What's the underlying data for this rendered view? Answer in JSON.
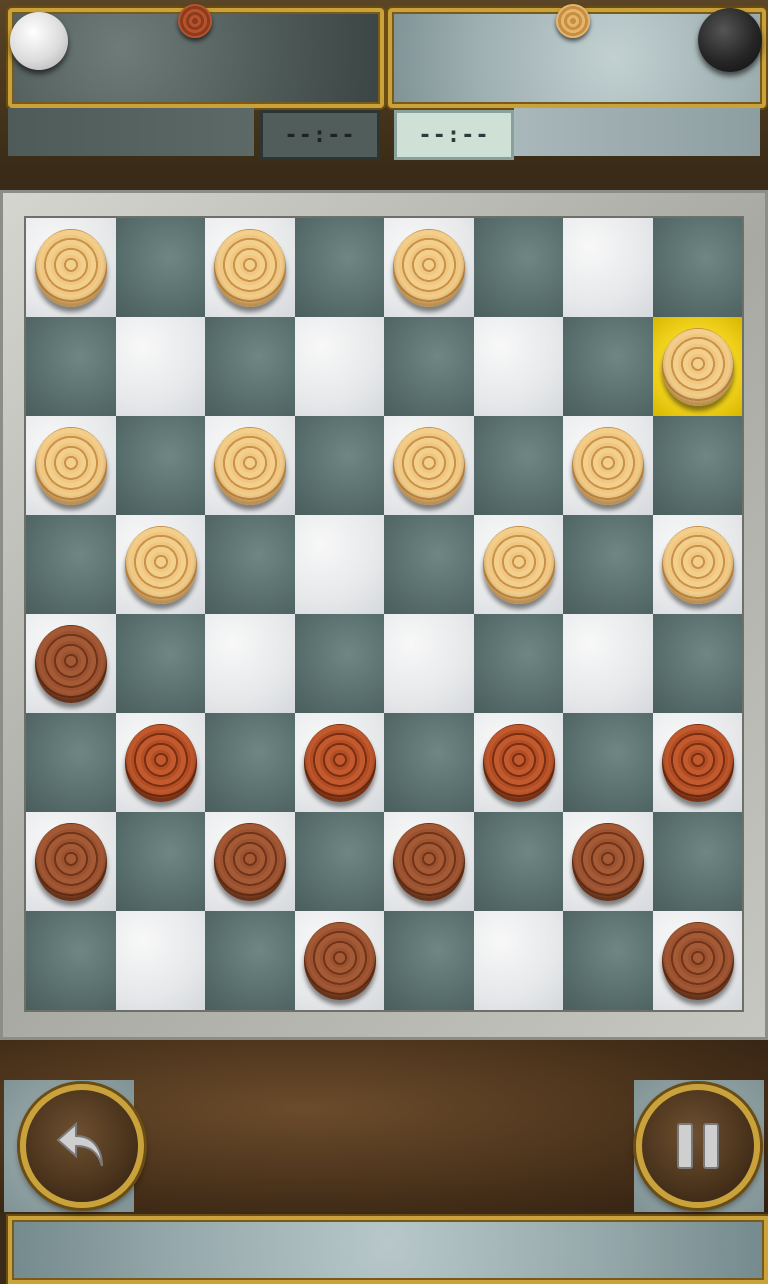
{
  "header": {
    "timer_dark": "--:--",
    "timer_light": "--:--"
  },
  "board": {
    "rows": 8,
    "cols": 8,
    "highlighted": [
      1,
      7
    ],
    "pieces": [
      [
        "L",
        "",
        "L",
        "",
        "L",
        "",
        "",
        ""
      ],
      [
        "",
        "",
        "",
        "",
        "",
        "",
        "",
        "L"
      ],
      [
        "L",
        "",
        "L",
        "",
        "L",
        "",
        "L",
        ""
      ],
      [
        "",
        "L",
        "",
        "",
        "",
        "L",
        "",
        "L"
      ],
      [
        "D",
        "",
        "",
        "",
        "",
        "",
        "",
        ""
      ],
      [
        "",
        "R",
        "",
        "R",
        "",
        "R",
        "",
        "R"
      ],
      [
        "D",
        "",
        "D",
        "",
        "D",
        "",
        "D",
        ""
      ],
      [
        "",
        "",
        "",
        "D",
        "",
        "",
        "",
        "D"
      ]
    ],
    "squares": [
      [
        "light",
        "dark",
        "light",
        "dark",
        "light",
        "dark",
        "light",
        "dark"
      ],
      [
        "dark",
        "light",
        "dark",
        "light",
        "dark",
        "light",
        "dark",
        "light"
      ],
      [
        "light",
        "dark",
        "light",
        "dark",
        "light",
        "dark",
        "light",
        "dark"
      ],
      [
        "dark",
        "light",
        "dark",
        "light",
        "dark",
        "light",
        "dark",
        "light"
      ],
      [
        "light",
        "dark",
        "light",
        "dark",
        "light",
        "dark",
        "light",
        "dark"
      ],
      [
        "dark",
        "light",
        "dark",
        "light",
        "dark",
        "light",
        "dark",
        "light"
      ],
      [
        "light",
        "dark",
        "light",
        "dark",
        "light",
        "dark",
        "light",
        "dark"
      ],
      [
        "dark",
        "light",
        "dark",
        "light",
        "dark",
        "light",
        "dark",
        "light"
      ]
    ]
  },
  "colors": {
    "gold_frame": "#c9a23c",
    "light_piece": "#e6b56c",
    "dark_piece": "#8e4a2a",
    "highlight": "#f0d21c"
  },
  "icons": {
    "undo": "undo-arrow-icon",
    "pause": "pause-icon"
  }
}
